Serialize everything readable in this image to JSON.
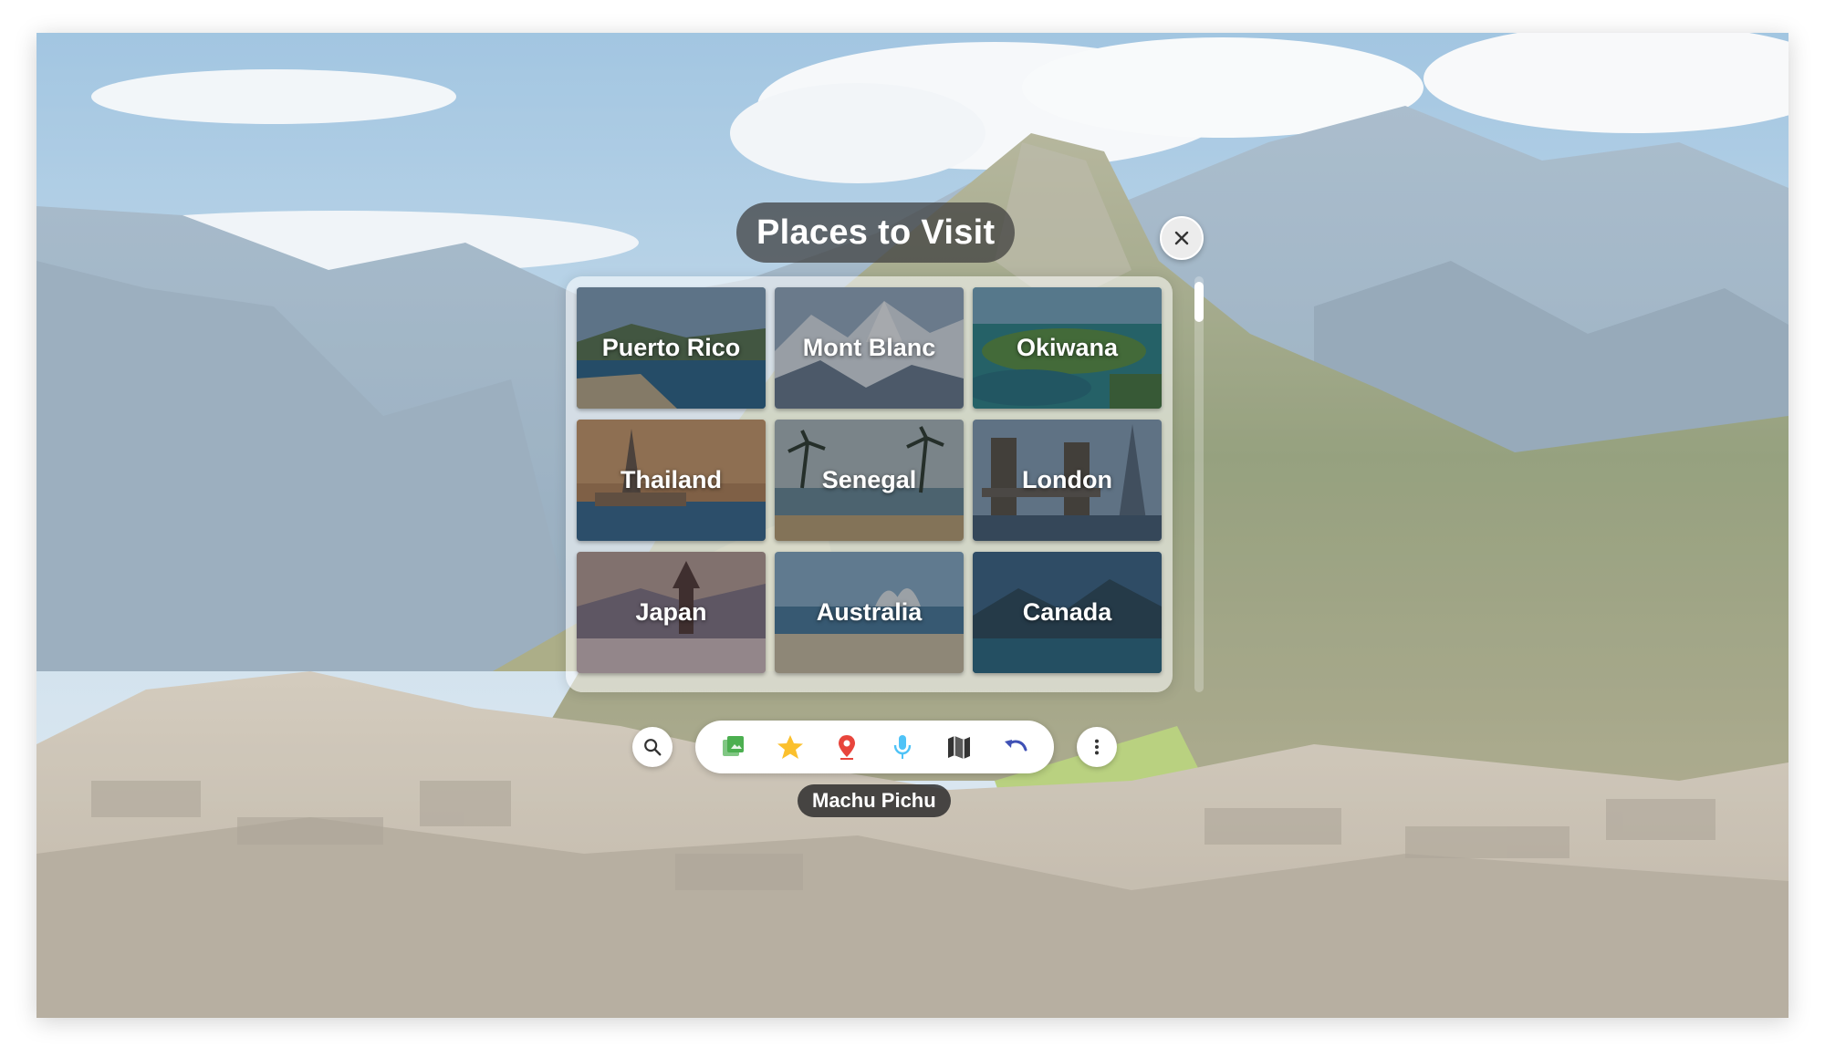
{
  "title": "Places to Visit",
  "location_label": "Machu Pichu",
  "places": [
    {
      "label": "Puerto Rico",
      "scene": "coast"
    },
    {
      "label": "Mont Blanc",
      "scene": "snow"
    },
    {
      "label": "Okiwana",
      "scene": "island"
    },
    {
      "label": "Thailand",
      "scene": "temple"
    },
    {
      "label": "Senegal",
      "scene": "palms"
    },
    {
      "label": "London",
      "scene": "bridge"
    },
    {
      "label": "Japan",
      "scene": "pagoda"
    },
    {
      "label": "Australia",
      "scene": "opera"
    },
    {
      "label": "Canada",
      "scene": "lake"
    }
  ],
  "toolbar": {
    "tools": [
      "gallery-icon",
      "star-icon",
      "location-pin-icon",
      "microphone-icon",
      "map-icon",
      "undo-icon"
    ]
  },
  "colors": {
    "sky": "#8db8d8",
    "mountain_green": "#6c7f4c",
    "ruins": "#b7ab99",
    "pin_red": "#e8453c",
    "star_yellow": "#fbc02d",
    "mic_blue": "#4fc3f7",
    "undo_blue": "#3f51b5",
    "gallery_green": "#4caf50"
  }
}
